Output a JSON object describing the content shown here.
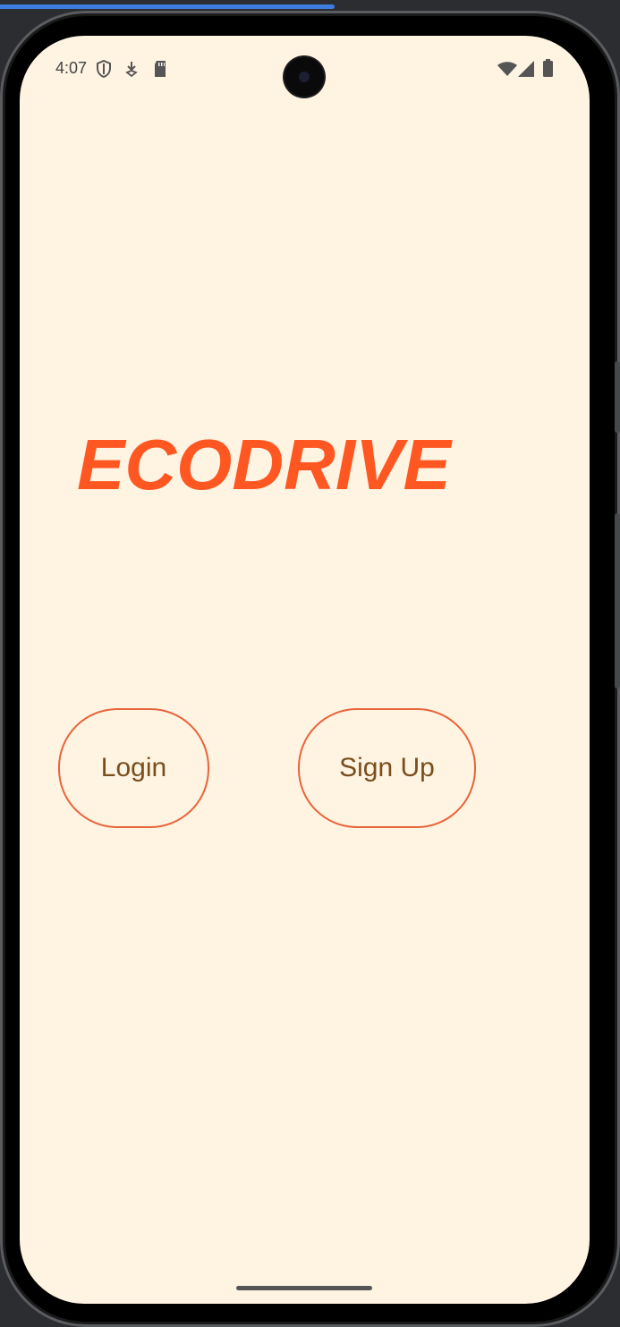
{
  "status_bar": {
    "time": "4:07",
    "left_icons": [
      "shield-icon",
      "download-badge-icon",
      "sd-card-icon"
    ],
    "right_icons": [
      "wifi-icon",
      "signal-icon",
      "battery-icon"
    ]
  },
  "app": {
    "title": "ECODRIVE",
    "accent_color": "#ff5722",
    "background_color": "#fff3e2",
    "button_text_color": "#7a4e1c"
  },
  "buttons": {
    "login_label": "Login",
    "signup_label": "Sign Up"
  },
  "emulator": {
    "loading_progress": 0.54
  }
}
